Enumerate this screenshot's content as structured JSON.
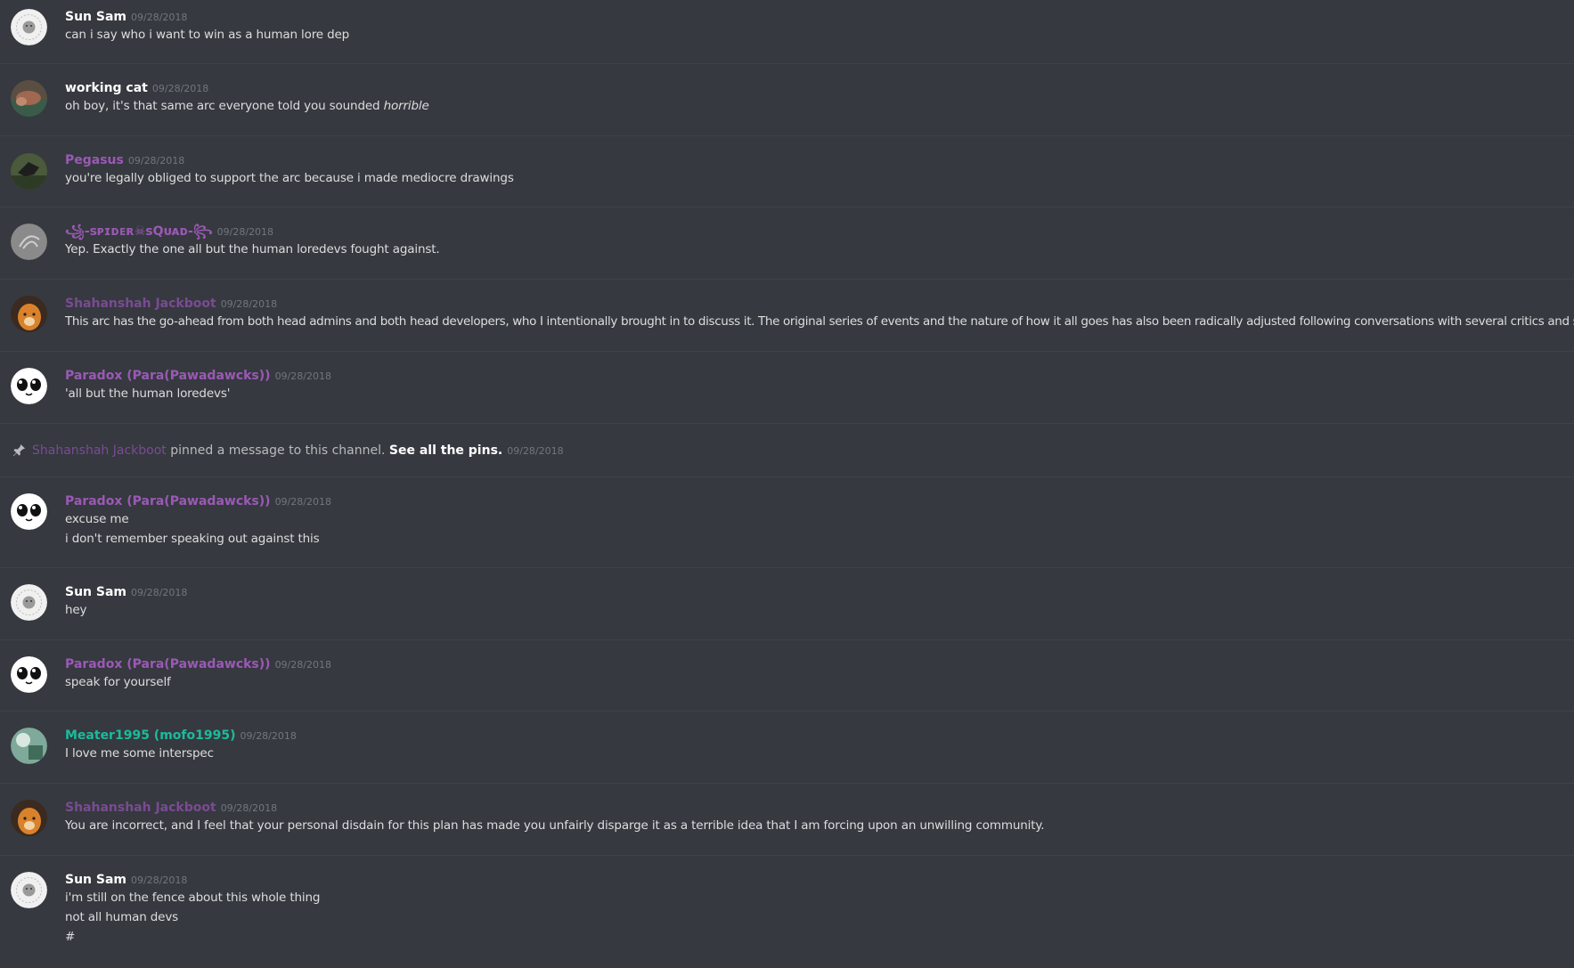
{
  "messages": [
    {
      "author": "Sun Sam",
      "timestamp": "09/28/2018",
      "lines": [
        "can i say who i want to win as a human lore dep"
      ]
    },
    {
      "author": "working cat",
      "timestamp": "09/28/2018",
      "lines": [
        "oh boy, it's that same arc everyone told you sounded "
      ],
      "emphasis": "horrible"
    },
    {
      "author": "Pegasus",
      "timestamp": "09/28/2018",
      "lines": [
        "you're legally obliged to support the arc because i made mediocre drawings"
      ]
    },
    {
      "author": "꧁-ꜱᴘɪᴅᴇʀ☠ꜱQᴜᴀᴅ-꧂",
      "timestamp": "09/28/2018",
      "lines": [
        "Yep. Exactly the one all but the human loredevs fought against."
      ]
    },
    {
      "author": "Shahanshah Jackboot",
      "timestamp": "09/28/2018",
      "lines": [
        "This arc has the go-ahead from both head admins and both head developers, who I intentionally brought in to discuss it. The original series of events and the nature of how it all goes has also been radically adjusted following conversations with several critics and supporters."
      ]
    },
    {
      "author": "Paradox (Para(Pawadawcks))",
      "timestamp": "09/28/2018",
      "lines": [
        "'all but the human loredevs'"
      ]
    },
    {
      "author": "Paradox (Para(Pawadawcks))",
      "timestamp": "09/28/2018",
      "lines": [
        "excuse me",
        "i don't remember speaking out against this"
      ]
    },
    {
      "author": "Sun Sam",
      "timestamp": "09/28/2018",
      "lines": [
        "hey"
      ]
    },
    {
      "author": "Paradox (Para(Pawadawcks))",
      "timestamp": "09/28/2018",
      "lines": [
        "speak for yourself"
      ]
    },
    {
      "author": "Meater1995 (mofo1995)",
      "timestamp": "09/28/2018",
      "lines": [
        "I love me some interspec"
      ]
    },
    {
      "author": "Shahanshah Jackboot",
      "timestamp": "09/28/2018",
      "lines": [
        "You are incorrect, and I feel that your personal disdain for this plan has made you unfairly disparge it as a terrible idea that I am forcing upon an unwilling community."
      ]
    },
    {
      "author": "Sun Sam",
      "timestamp": "09/28/2018",
      "lines": [
        "i'm still on the fence about this whole thing",
        "not all human devs",
        "#"
      ]
    }
  ],
  "system_message": {
    "user": "Shahanshah Jackboot",
    "text": " pinned a message to this channel. ",
    "link": "See all the pins.",
    "timestamp": "09/28/2018"
  },
  "colors": {
    "background": "#36393f",
    "text": "#dcddde",
    "timestamp": "#72767d",
    "white_name": "#ffffff",
    "purple_name": "#9b59b6",
    "teal_name": "#1abc9c"
  },
  "icons": {
    "pin": "pin-icon"
  }
}
